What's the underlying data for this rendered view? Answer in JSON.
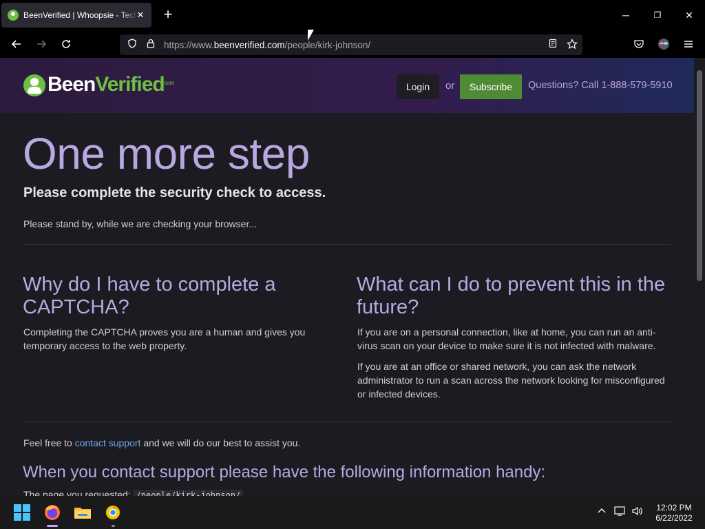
{
  "browser": {
    "tab_title": "BeenVerified | Whoopsie - Technical Difficulties",
    "tab_close": "✕",
    "new_tab": "+",
    "url_prefix": "https://www.",
    "url_host": "beenverified.com",
    "url_path": "/people/kirk-johnson/",
    "window_controls": {
      "minimize": "─",
      "restore": "❐",
      "close": "✕"
    }
  },
  "site": {
    "logo_been": "Been",
    "logo_verified": "Verified",
    "logo_sub": ".com",
    "login": "Login",
    "or": "or",
    "subscribe": "Subscribe",
    "questions": "Questions? Call 1-888-579-5910"
  },
  "content": {
    "title": "One more step",
    "subtitle": "Please complete the security check to access.",
    "standby": "Please stand by, while we are checking your browser...",
    "why_heading": "Why do I have to complete a CAPTCHA?",
    "why_text": "Completing the CAPTCHA proves you are a human and gives you temporary access to the web property.",
    "prevent_heading": "What can I do to prevent this in the future?",
    "prevent_text_1": "If you are on a personal connection, like at home, you can run an anti-virus scan on your device to make sure it is not infected with malware.",
    "prevent_text_2": "If you are at an office or shared network, you can ask the network administrator to run a scan across the network looking for misconfigured or infected devices.",
    "feel_free_before": "Feel free to ",
    "feel_free_link": "contact support",
    "feel_free_after": " and we will do our best to assist you.",
    "contact_heading": "When you contact support please have the following information handy:",
    "page_requested_label": "The page you requested: ",
    "page_requested_value": "/people/kirk-johnson/"
  },
  "taskbar": {
    "time": "12:02 PM",
    "date": "6/22/2022"
  },
  "colors": {
    "accent_purple": "#b9a8e0",
    "brand_green": "#6fbf44",
    "subscribe_green": "#4f8b35",
    "link_blue": "#6ea8e6"
  }
}
